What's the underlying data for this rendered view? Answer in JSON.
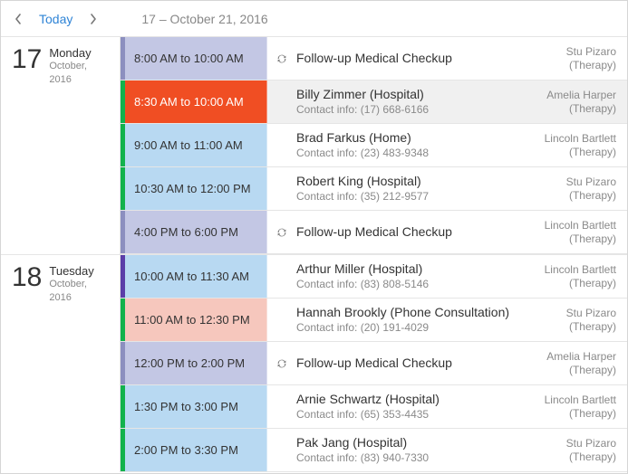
{
  "toolbar": {
    "today_label": "Today",
    "range_label": "17 – October 21, 2016"
  },
  "days": [
    {
      "day_num": "17",
      "day_name": "Monday",
      "day_sub": "October, 2016",
      "appts": [
        {
          "time": "8:00 AM to 10:00 AM",
          "chip_bg": "#c3c7e4",
          "chip_accent": "#8c8fbf",
          "selected": false,
          "recurring": true,
          "title": "Follow-up Medical Checkup",
          "sub": "",
          "staff": "Stu Pizaro",
          "role": "(Therapy)"
        },
        {
          "time": "8:30 AM to 10:00 AM",
          "chip_bg": "#f04e23",
          "chip_accent": "#12b24c",
          "chip_text": "#ffffff",
          "selected": true,
          "recurring": false,
          "title": "Billy Zimmer (Hospital)",
          "sub": "Contact info: (17) 668-6166",
          "staff": "Amelia Harper",
          "role": "(Therapy)"
        },
        {
          "time": "9:00 AM to 11:00 AM",
          "chip_bg": "#b8d9f2",
          "chip_accent": "#12b24c",
          "selected": false,
          "recurring": false,
          "title": "Brad Farkus (Home)",
          "sub": "Contact info: (23) 483-9348",
          "staff": "Lincoln Bartlett",
          "role": "(Therapy)"
        },
        {
          "time": "10:30 AM to 12:00 PM",
          "chip_bg": "#b8d9f2",
          "chip_accent": "#12b24c",
          "selected": false,
          "recurring": false,
          "title": "Robert King (Hospital)",
          "sub": "Contact info: (35) 212-9577",
          "staff": "Stu Pizaro",
          "role": "(Therapy)"
        },
        {
          "time": "4:00 PM to 6:00 PM",
          "chip_bg": "#c3c7e4",
          "chip_accent": "#8c8fbf",
          "selected": false,
          "recurring": true,
          "title": "Follow-up Medical Checkup",
          "sub": "",
          "staff": "Lincoln Bartlett",
          "role": "(Therapy)"
        }
      ]
    },
    {
      "day_num": "18",
      "day_name": "Tuesday",
      "day_sub": "October, 2016",
      "appts": [
        {
          "time": "10:00 AM to 11:30 AM",
          "chip_bg": "#b8d9f2",
          "chip_accent": "#5b3ea8",
          "selected": false,
          "recurring": false,
          "title": "Arthur Miller (Hospital)",
          "sub": "Contact info: (83) 808-5146",
          "staff": "Lincoln Bartlett",
          "role": "(Therapy)"
        },
        {
          "time": "11:00 AM to 12:30 PM",
          "chip_bg": "#f6c7bd",
          "chip_accent": "#12b24c",
          "selected": false,
          "recurring": false,
          "title": "Hannah Brookly (Phone Consultation)",
          "sub": "Contact info: (20) 191-4029",
          "staff": "Stu Pizaro",
          "role": "(Therapy)"
        },
        {
          "time": "12:00 PM to 2:00 PM",
          "chip_bg": "#c3c7e4",
          "chip_accent": "#8c8fbf",
          "selected": false,
          "recurring": true,
          "title": "Follow-up Medical Checkup",
          "sub": "",
          "staff": "Amelia Harper",
          "role": "(Therapy)"
        },
        {
          "time": "1:30 PM to 3:00 PM",
          "chip_bg": "#b8d9f2",
          "chip_accent": "#12b24c",
          "selected": false,
          "recurring": false,
          "title": "Arnie Schwartz (Hospital)",
          "sub": "Contact info: (65) 353-4435",
          "staff": "Lincoln Bartlett",
          "role": "(Therapy)"
        },
        {
          "time": "2:00 PM to 3:30 PM",
          "chip_bg": "#b8d9f2",
          "chip_accent": "#12b24c",
          "selected": false,
          "recurring": false,
          "title": "Pak Jang (Hospital)",
          "sub": "Contact info: (83) 940-7330",
          "staff": "Stu Pizaro",
          "role": "(Therapy)"
        }
      ]
    }
  ]
}
